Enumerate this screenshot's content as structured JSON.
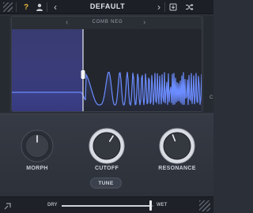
{
  "topbar": {
    "help_icon_glyph": "?",
    "user_icon_glyph": "▲",
    "prev_glyph": "‹",
    "preset_name": "DEFAULT",
    "next_glyph": "›",
    "save_icon_glyph": "⭳",
    "random_icon_glyph": "⤨"
  },
  "display": {
    "mode_name": "COMB NEG",
    "prev_glyph": "‹",
    "next_glyph": "›",
    "cutoff_fraction": 0.37,
    "accent_color": "#5b5fd6",
    "wave_color": "#6b8cff"
  },
  "right_strip": {
    "label": "C"
  },
  "knobs": [
    {
      "label": "MORPH",
      "value_fraction": 0.5,
      "style": "dark"
    },
    {
      "label": "CUTOFF",
      "value_fraction": 0.62,
      "style": "light"
    },
    {
      "label": "RESONANCE",
      "value_fraction": 0.42,
      "style": "light"
    }
  ],
  "tune": {
    "label": "TUNE"
  },
  "mix": {
    "dry_label": "DRY",
    "wet_label": "WET",
    "value_fraction": 0.97
  },
  "icons": {
    "top_left": "stripes-icon",
    "help": "help-icon",
    "user": "user-icon",
    "save": "save-icon",
    "random": "shuffle-icon",
    "bottom_left": "link-icon"
  }
}
